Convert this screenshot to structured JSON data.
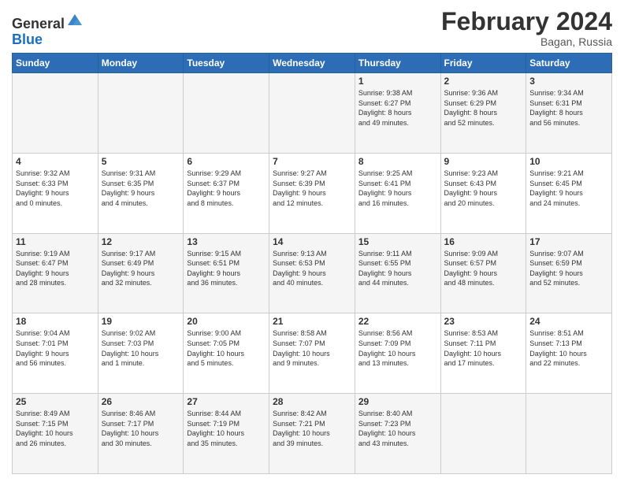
{
  "header": {
    "logo_line1": "General",
    "logo_line2": "Blue",
    "month_year": "February 2024",
    "location": "Bagan, Russia"
  },
  "days_of_week": [
    "Sunday",
    "Monday",
    "Tuesday",
    "Wednesday",
    "Thursday",
    "Friday",
    "Saturday"
  ],
  "weeks": [
    {
      "days": [
        {
          "num": "",
          "info": ""
        },
        {
          "num": "",
          "info": ""
        },
        {
          "num": "",
          "info": ""
        },
        {
          "num": "",
          "info": ""
        },
        {
          "num": "1",
          "info": "Sunrise: 9:38 AM\nSunset: 6:27 PM\nDaylight: 8 hours\nand 49 minutes."
        },
        {
          "num": "2",
          "info": "Sunrise: 9:36 AM\nSunset: 6:29 PM\nDaylight: 8 hours\nand 52 minutes."
        },
        {
          "num": "3",
          "info": "Sunrise: 9:34 AM\nSunset: 6:31 PM\nDaylight: 8 hours\nand 56 minutes."
        }
      ]
    },
    {
      "days": [
        {
          "num": "4",
          "info": "Sunrise: 9:32 AM\nSunset: 6:33 PM\nDaylight: 9 hours\nand 0 minutes."
        },
        {
          "num": "5",
          "info": "Sunrise: 9:31 AM\nSunset: 6:35 PM\nDaylight: 9 hours\nand 4 minutes."
        },
        {
          "num": "6",
          "info": "Sunrise: 9:29 AM\nSunset: 6:37 PM\nDaylight: 9 hours\nand 8 minutes."
        },
        {
          "num": "7",
          "info": "Sunrise: 9:27 AM\nSunset: 6:39 PM\nDaylight: 9 hours\nand 12 minutes."
        },
        {
          "num": "8",
          "info": "Sunrise: 9:25 AM\nSunset: 6:41 PM\nDaylight: 9 hours\nand 16 minutes."
        },
        {
          "num": "9",
          "info": "Sunrise: 9:23 AM\nSunset: 6:43 PM\nDaylight: 9 hours\nand 20 minutes."
        },
        {
          "num": "10",
          "info": "Sunrise: 9:21 AM\nSunset: 6:45 PM\nDaylight: 9 hours\nand 24 minutes."
        }
      ]
    },
    {
      "days": [
        {
          "num": "11",
          "info": "Sunrise: 9:19 AM\nSunset: 6:47 PM\nDaylight: 9 hours\nand 28 minutes."
        },
        {
          "num": "12",
          "info": "Sunrise: 9:17 AM\nSunset: 6:49 PM\nDaylight: 9 hours\nand 32 minutes."
        },
        {
          "num": "13",
          "info": "Sunrise: 9:15 AM\nSunset: 6:51 PM\nDaylight: 9 hours\nand 36 minutes."
        },
        {
          "num": "14",
          "info": "Sunrise: 9:13 AM\nSunset: 6:53 PM\nDaylight: 9 hours\nand 40 minutes."
        },
        {
          "num": "15",
          "info": "Sunrise: 9:11 AM\nSunset: 6:55 PM\nDaylight: 9 hours\nand 44 minutes."
        },
        {
          "num": "16",
          "info": "Sunrise: 9:09 AM\nSunset: 6:57 PM\nDaylight: 9 hours\nand 48 minutes."
        },
        {
          "num": "17",
          "info": "Sunrise: 9:07 AM\nSunset: 6:59 PM\nDaylight: 9 hours\nand 52 minutes."
        }
      ]
    },
    {
      "days": [
        {
          "num": "18",
          "info": "Sunrise: 9:04 AM\nSunset: 7:01 PM\nDaylight: 9 hours\nand 56 minutes."
        },
        {
          "num": "19",
          "info": "Sunrise: 9:02 AM\nSunset: 7:03 PM\nDaylight: 10 hours\nand 1 minute."
        },
        {
          "num": "20",
          "info": "Sunrise: 9:00 AM\nSunset: 7:05 PM\nDaylight: 10 hours\nand 5 minutes."
        },
        {
          "num": "21",
          "info": "Sunrise: 8:58 AM\nSunset: 7:07 PM\nDaylight: 10 hours\nand 9 minutes."
        },
        {
          "num": "22",
          "info": "Sunrise: 8:56 AM\nSunset: 7:09 PM\nDaylight: 10 hours\nand 13 minutes."
        },
        {
          "num": "23",
          "info": "Sunrise: 8:53 AM\nSunset: 7:11 PM\nDaylight: 10 hours\nand 17 minutes."
        },
        {
          "num": "24",
          "info": "Sunrise: 8:51 AM\nSunset: 7:13 PM\nDaylight: 10 hours\nand 22 minutes."
        }
      ]
    },
    {
      "days": [
        {
          "num": "25",
          "info": "Sunrise: 8:49 AM\nSunset: 7:15 PM\nDaylight: 10 hours\nand 26 minutes."
        },
        {
          "num": "26",
          "info": "Sunrise: 8:46 AM\nSunset: 7:17 PM\nDaylight: 10 hours\nand 30 minutes."
        },
        {
          "num": "27",
          "info": "Sunrise: 8:44 AM\nSunset: 7:19 PM\nDaylight: 10 hours\nand 35 minutes."
        },
        {
          "num": "28",
          "info": "Sunrise: 8:42 AM\nSunset: 7:21 PM\nDaylight: 10 hours\nand 39 minutes."
        },
        {
          "num": "29",
          "info": "Sunrise: 8:40 AM\nSunset: 7:23 PM\nDaylight: 10 hours\nand 43 minutes."
        },
        {
          "num": "",
          "info": ""
        },
        {
          "num": "",
          "info": ""
        }
      ]
    }
  ]
}
